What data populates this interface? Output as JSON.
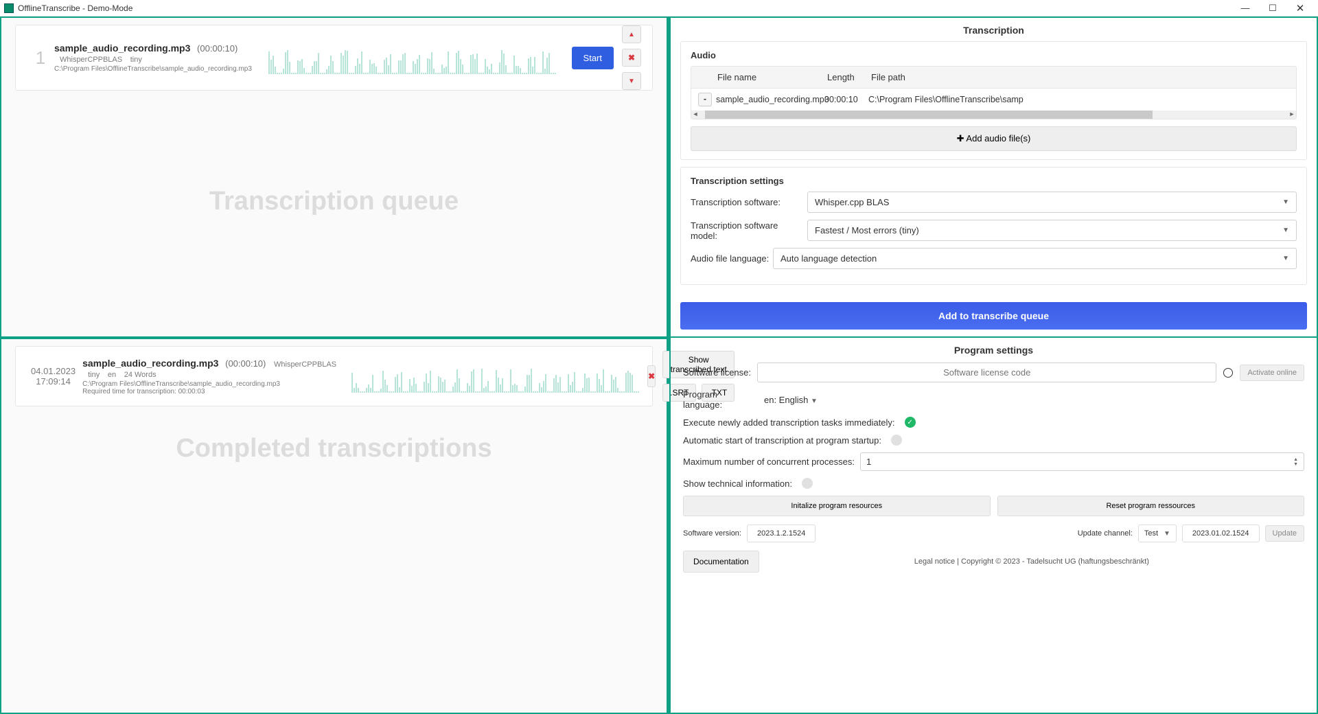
{
  "window": {
    "title": "OfflineTranscribe - Demo-Mode"
  },
  "queue": {
    "watermark": "Transcription queue",
    "item": {
      "index": "1",
      "filename": "sample_audio_recording.mp3",
      "duration": "(00:00:10)",
      "engine": "WhisperCPPBLAS",
      "model": "tiny",
      "path": "C:\\Program Files\\OfflineTranscribe\\sample_audio_recording.mp3",
      "start_label": "Start"
    }
  },
  "completed": {
    "watermark": "Completed transcriptions",
    "item": {
      "timestamp": "04.01.2023 17:09:14",
      "filename": "sample_audio_recording.mp3",
      "duration": "(00:00:10)",
      "engine": "WhisperCPPBLAS",
      "model": "tiny",
      "lang": "en",
      "wordcount": "24 Words",
      "path": "C:\\Program Files\\OfflineTranscribe\\sample_audio_recording.mp3",
      "required_time": "Required time for transcription:  00:00:03",
      "show_text": "Show transcribed text",
      "srt": ".SRT",
      "txt": ".TXT"
    }
  },
  "transcription": {
    "heading": "Transcription",
    "audio_heading": "Audio",
    "table": {
      "col_filename": "File name",
      "col_length": "Length",
      "col_path": "File path",
      "row": {
        "filename": "sample_audio_recording.mp3",
        "length": "00:00:10",
        "path": "C:\\Program Files\\OfflineTranscribe\\samp"
      }
    },
    "add_audio": "Add audio file(s)",
    "settings_heading": "Transcription settings",
    "software_label": "Transcription software:",
    "software_value": "Whisper.cpp BLAS",
    "model_label": "Transcription software model:",
    "model_value": "Fastest / Most errors (tiny)",
    "lang_label": "Audio file language:",
    "lang_value": "Auto language detection",
    "add_queue": "Add to transcribe queue"
  },
  "settings": {
    "heading": "Program settings",
    "license_label": "Software license:",
    "license_placeholder": "Software license code",
    "activate": "Activate online",
    "proglang_label": "Program language:",
    "proglang_value": "en: English",
    "execute_label": "Execute newly added transcription tasks immediately:",
    "autostart_label": "Automatic start of transcription at program startup:",
    "maxproc_label": "Maximum number of concurrent processes:",
    "maxproc_value": "1",
    "techinfo_label": "Show technical information:",
    "init_btn": "Initalize program resources",
    "reset_btn": "Reset program ressources",
    "version_label": "Software version:",
    "version_value": "2023.1.2.1524",
    "channel_label": "Update channel:",
    "channel_value": "Test",
    "channel_ver": "2023.01.02.1524",
    "update_btn": "Update",
    "doc_btn": "Documentation",
    "legal": "Legal notice | Copyright © 2023 - Tadelsucht UG (haftungsbeschränkt)"
  }
}
